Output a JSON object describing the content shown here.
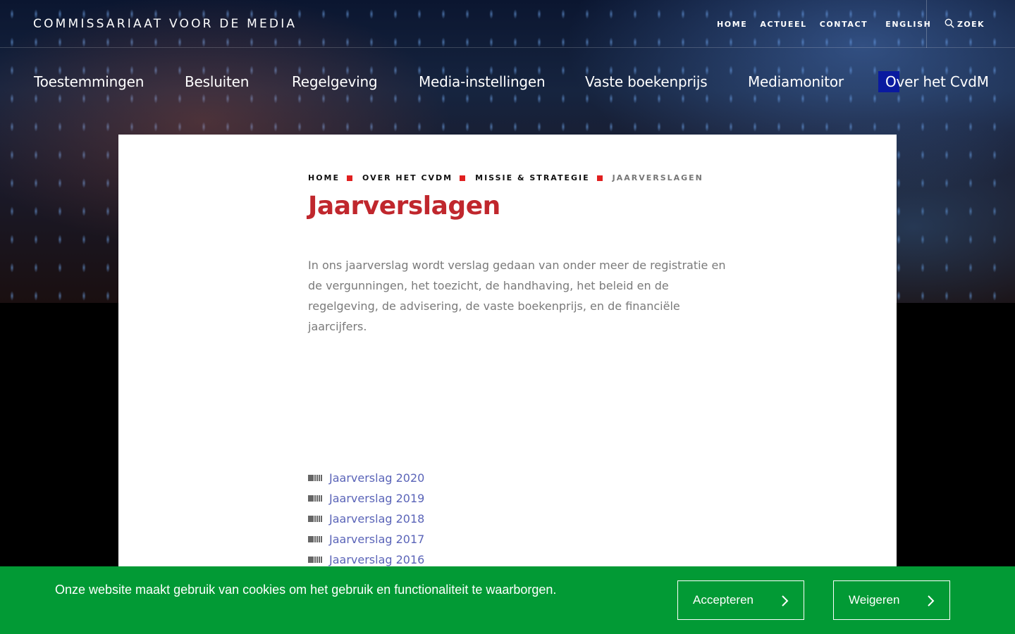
{
  "site": {
    "logo_text": "COMMISSARIAAT VOOR DE MEDIA"
  },
  "utility_nav": {
    "home": "HOME",
    "actueel": "ACTUEEL",
    "contact": "CONTACT",
    "english": "ENGLISH",
    "search": "ZOEK"
  },
  "main_nav": {
    "items": [
      {
        "label": "Toestemmingen"
      },
      {
        "label": "Besluiten"
      },
      {
        "label": "Regelgeving"
      },
      {
        "label": "Media-instellingen"
      },
      {
        "label": "Vaste boekenprijs"
      },
      {
        "label": "Mediamonitor"
      },
      {
        "label": "Over het CvdM",
        "active": true
      }
    ]
  },
  "breadcrumb": {
    "items": [
      "HOME",
      "OVER HET CVDM",
      "MISSIE & STRATEGIE",
      "JAARVERSLAGEN"
    ]
  },
  "page": {
    "title": "Jaarverslagen",
    "intro": "In ons jaarverslag wordt verslag gedaan van onder meer de registratie en de vergunningen, het toezicht, de handhaving, het beleid en de regelgeving, de advisering, de vaste boekenprijs, en de financiële jaarcijfers."
  },
  "reports": {
    "items": [
      {
        "label": "Jaarverslag 2020"
      },
      {
        "label": "Jaarverslag 2019"
      },
      {
        "label": "Jaarverslag 2018"
      },
      {
        "label": "Jaarverslag 2017"
      },
      {
        "label": "Jaarverslag 2016"
      }
    ]
  },
  "cookie_banner": {
    "text": "Onze website maakt gebruik van cookies om het gebruik en functionaliteit te waarborgen.",
    "accept_label": "Accepteren",
    "decline_label": "Weigeren"
  },
  "colors": {
    "title_red": "#c0272d",
    "breadcrumb_separator": "#e02020",
    "link_blue": "#5a64b8",
    "cookie_green": "#029a35",
    "active_nav_marker": "#0a1aa0"
  }
}
